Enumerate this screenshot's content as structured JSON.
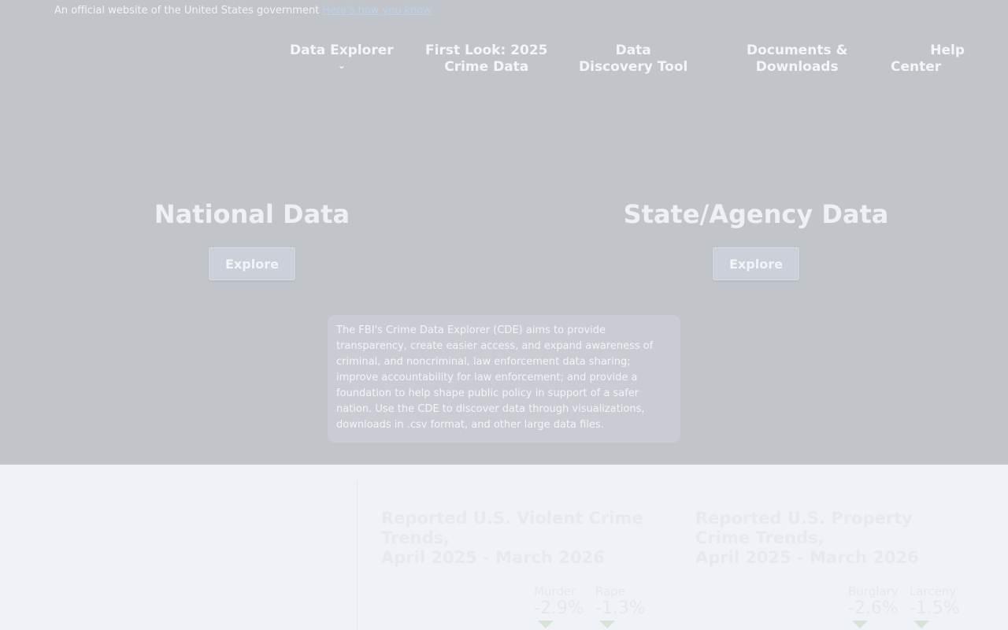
{
  "banner": {
    "text": "An official website of the United States government",
    "link": "Here's how you know"
  },
  "nav": [
    {
      "label_1": "Data Explorer",
      "has_dropdown": true
    },
    {
      "label_1": "First Look: 2025",
      "label_2": "Crime Data"
    },
    {
      "label_1": "Data",
      "label_2": "Discovery Tool"
    },
    {
      "label_1": "Documents &",
      "label_2": "Downloads"
    },
    {
      "label_1": "Help",
      "label_2": "Center"
    }
  ],
  "hero": {
    "national": {
      "title": "National Data",
      "button": "Explore"
    },
    "state": {
      "title": "State/Agency Data",
      "button": "Explore"
    }
  },
  "about": "The FBI's Crime Data Explorer (CDE) aims to provide transparency, create easier access, and expand awareness of criminal, and noncriminal, law enforcement data sharing; improve accountability for law enforcement; and provide a foundation to help shape public policy in support of a safer nation. Use the CDE to discover data through visualizations, downloads in .csv format, and other large data files.",
  "trends": {
    "violent": {
      "title_1": "Reported U.S. Violent Crime",
      "title_2": "Trends,",
      "title_3": "April 2025 - March 2026",
      "stats": [
        {
          "name": "Murder",
          "value": "-2.9%"
        },
        {
          "name": "Rape",
          "value": "-1.3%"
        }
      ]
    },
    "property": {
      "title_1": "Reported U.S. Property",
      "title_2": "Crime Trends,",
      "title_3": "April 2025 - March 2026",
      "stats": [
        {
          "name": "Burglary",
          "value": "-2.6%"
        },
        {
          "name": "Larceny",
          "value": "-1.5%"
        }
      ]
    }
  },
  "colors": {
    "overlay": "#c1c4c9",
    "lower_bg": "#eff2f6",
    "link": "#b9d3ec"
  }
}
